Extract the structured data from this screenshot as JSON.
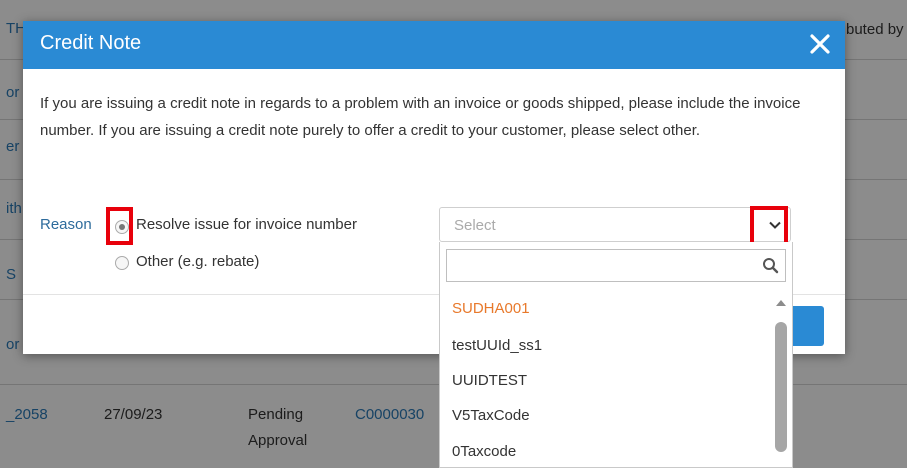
{
  "background": {
    "row_fragments": [
      "TH",
      "or",
      "er",
      "ith",
      "S",
      "or"
    ],
    "top_right_text": "buted by",
    "bottom_row": {
      "id": "_2058",
      "date": "27/09/23",
      "status_line1": "Pending",
      "status_line2": "Approval",
      "ref": "C0000030"
    }
  },
  "modal": {
    "title": "Credit Note",
    "close_icon": "close-icon",
    "description": "If you are issuing a credit note in regards to a problem with an invoice or goods shipped, please include the invoice number. If you are issuing a credit note purely to offer a credit to your customer, please select other.",
    "reason_label": "Reason",
    "options": [
      {
        "label": "Resolve issue for invoice number",
        "checked": true
      },
      {
        "label": "Other (e.g. rebate)",
        "checked": false
      }
    ],
    "select": {
      "placeholder": "Select",
      "icon": "chevron-down-icon"
    }
  },
  "dropdown": {
    "search_value": "",
    "search_icon": "search-icon",
    "items": [
      {
        "label": "SUDHA001",
        "highlighted": true
      },
      {
        "label": "testUUId_ss1",
        "highlighted": false
      },
      {
        "label": "UUIDTEST",
        "highlighted": false
      },
      {
        "label": "V5TaxCode",
        "highlighted": false
      },
      {
        "label": "0Taxcode",
        "highlighted": false
      }
    ]
  },
  "colors": {
    "header": "#2a8ad4",
    "highlight_box": "#e8000b",
    "active_item": "#e8792b",
    "reason_label": "#2d6b9c"
  }
}
